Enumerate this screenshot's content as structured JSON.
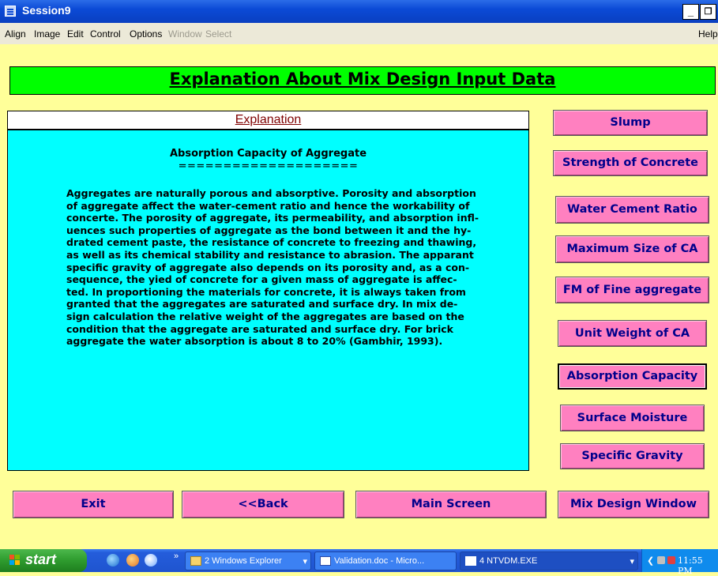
{
  "window": {
    "title": "Session9"
  },
  "menubar": {
    "items": [
      {
        "label": "Align",
        "enabled": true
      },
      {
        "label": "Image",
        "enabled": true
      },
      {
        "label": "Edit",
        "enabled": true
      },
      {
        "label": "Control",
        "enabled": true
      },
      {
        "label": "Options",
        "enabled": true
      },
      {
        "label": "Window",
        "enabled": false
      },
      {
        "label": "Select",
        "enabled": false
      }
    ],
    "help": "Help"
  },
  "header": {
    "title": "Explanation About Mix Design Input Data"
  },
  "explanation": {
    "heading": "Explanation",
    "subject": "Absorption Capacity of Aggregate",
    "underline": "====================",
    "body": "Aggregates are naturally porous and absorptive. Porosity and absorption\nof aggregate affect the water-cement ratio and hence the workability of\nconcerte. The porosity of aggregate, its permeability, and absorption infl-\nuences such properties of aggregate as the bond between it and the hy-\ndrated cement paste, the resistance of concrete to freezing and thawing,\nas well as its chemical stability and resistance to abrasion. The apparant\nspecific gravity of aggregate also depends on its porosity and, as a con-\nsequence, the yied of concrete for a given mass of aggregate is affec-\nted. In proportioning the materials for concrete, it is always taken from\ngranted that the aggregates are saturated and surface dry. In mix de-\nsign calculation the relative weight of the aggregates are based on the\ncondition that the aggregate are saturated and surface dry. For brick\naggregate the water absorption is about 8 to 20% (Gambhir, 1993)."
  },
  "topics": [
    "Slump",
    "Strength of Concrete",
    "Water Cement Ratio",
    "Maximum Size of CA",
    "FM of Fine aggregate",
    "Unit Weight of CA",
    "Absorption Capacity",
    "Surface Moisture",
    "Specific Gravity"
  ],
  "selected_topic": "Absorption Capacity",
  "nav": {
    "exit": "Exit",
    "back": "<<Back",
    "main": "Main Screen",
    "mix": "Mix Design Window"
  },
  "taskbar": {
    "start": "start",
    "tasks": [
      "2 Windows Explorer",
      "Validation.doc - Micro...",
      "4 NTVDM.EXE"
    ],
    "clock": "11:55 PM"
  },
  "colors": {
    "background": "#ffff99",
    "header_band": "#00ff00",
    "panel": "#00ffff",
    "button": "#ff80c0",
    "button_text": "#00008b",
    "heading_text": "#800000"
  }
}
